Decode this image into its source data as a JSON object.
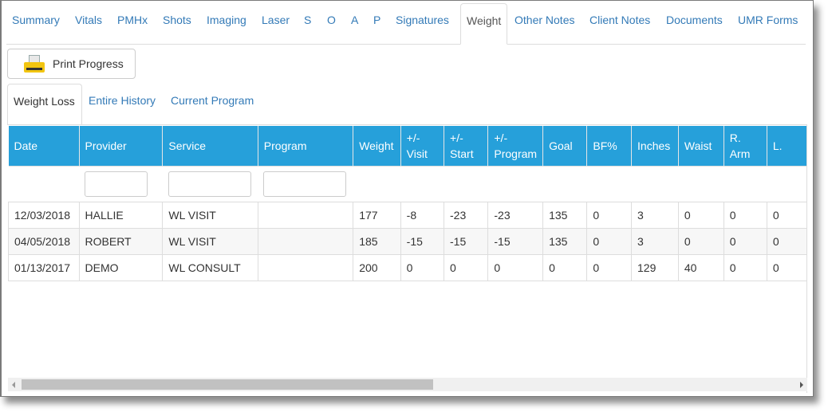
{
  "top_tabs": [
    {
      "label": "Summary",
      "active": false
    },
    {
      "label": "Vitals",
      "active": false
    },
    {
      "label": "PMHx",
      "active": false
    },
    {
      "label": "Shots",
      "active": false
    },
    {
      "label": "Imaging",
      "active": false
    },
    {
      "label": "Laser",
      "active": false
    },
    {
      "label": "S",
      "active": false
    },
    {
      "label": "O",
      "active": false
    },
    {
      "label": "A",
      "active": false
    },
    {
      "label": "P",
      "active": false
    },
    {
      "label": "Signatures",
      "active": false
    },
    {
      "label": "Weight",
      "active": true
    },
    {
      "label": "Other Notes",
      "active": false
    },
    {
      "label": "Client Notes",
      "active": false
    },
    {
      "label": "Documents",
      "active": false
    },
    {
      "label": "UMR Forms",
      "active": false
    }
  ],
  "toolbar": {
    "print_label": "Print Progress",
    "print_icon": "printer-icon"
  },
  "sub_tabs": [
    {
      "label": "Weight Loss",
      "active": true
    },
    {
      "label": "Entire History",
      "active": false
    },
    {
      "label": "Current Program",
      "active": false
    }
  ],
  "grid": {
    "header_color": "#26a0da",
    "columns": [
      "Date",
      "Provider",
      "Service",
      "Program",
      "Weight",
      "+/- Visit",
      "+/- Start",
      "+/- Program",
      "Goal",
      "BF%",
      "Inches",
      "Waist",
      "R. Arm",
      "L."
    ],
    "filters": {
      "provider": "",
      "service": "",
      "program": ""
    },
    "rows": [
      [
        "12/03/2018",
        "HALLIE",
        "WL VISIT",
        "",
        "177",
        "-8",
        "-23",
        "-23",
        "135",
        "0",
        "3",
        "0",
        "0",
        "0"
      ],
      [
        "04/05/2018",
        "ROBERT",
        "WL VISIT",
        "",
        "185",
        "-15",
        "-15",
        "-15",
        "135",
        "0",
        "3",
        "0",
        "0",
        "0"
      ],
      [
        "01/13/2017",
        "DEMO",
        "WL CONSULT",
        "",
        "200",
        "0",
        "0",
        "0",
        "0",
        "0",
        "129",
        "40",
        "0",
        "0"
      ]
    ]
  }
}
